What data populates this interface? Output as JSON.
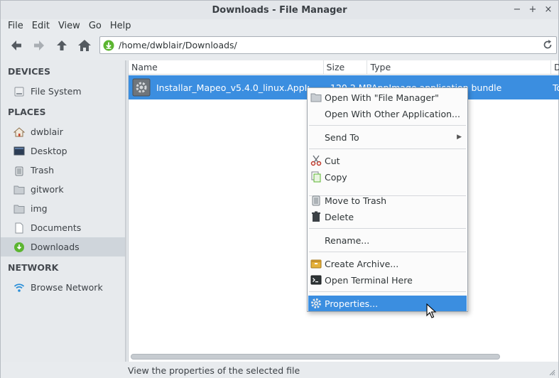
{
  "window": {
    "title": "Downloads - File Manager",
    "buttons": [
      "−",
      "+",
      "×"
    ]
  },
  "menubar": [
    "File",
    "Edit",
    "View",
    "Go",
    "Help"
  ],
  "toolbar": {
    "address": "/home/dwblair/Downloads/"
  },
  "sidebar": {
    "devices_header": "DEVICES",
    "devices": [
      {
        "label": "File System",
        "icon": "drive-icon"
      }
    ],
    "places_header": "PLACES",
    "places": [
      {
        "label": "dwblair",
        "icon": "home-icon"
      },
      {
        "label": "Desktop",
        "icon": "desktop-icon"
      },
      {
        "label": "Trash",
        "icon": "trash-icon"
      },
      {
        "label": "gitwork",
        "icon": "folder-icon"
      },
      {
        "label": "img",
        "icon": "folder-icon"
      },
      {
        "label": "Documents",
        "icon": "documents-icon"
      },
      {
        "label": "Downloads",
        "icon": "downloads-icon",
        "active": true
      }
    ],
    "network_header": "NETWORK",
    "network": [
      {
        "label": "Browse Network",
        "icon": "wifi-icon"
      }
    ]
  },
  "file_list": {
    "columns": [
      "Name",
      "Size",
      "Type",
      "D"
    ],
    "rows": [
      {
        "name": "Installar_Mapeo_v5.4.0_linux.AppImage",
        "size": "120.2 MB",
        "type": "AppImage application bundle",
        "date": "To"
      }
    ]
  },
  "context_menu": {
    "items": [
      {
        "label": "Open With \"File Manager\"",
        "icon": "folder-icon"
      },
      {
        "label": "Open With Other Application...",
        "icon": ""
      },
      {
        "label": "Send To",
        "icon": "",
        "submenu": true
      },
      {
        "label": "Cut",
        "icon": "scissors-icon"
      },
      {
        "label": "Copy",
        "icon": "copy-icon"
      },
      {
        "label": "Move to Trash",
        "icon": "trash-icon"
      },
      {
        "label": "Delete",
        "icon": "delete-icon"
      },
      {
        "label": "Rename...",
        "icon": ""
      },
      {
        "label": "Create Archive...",
        "icon": "archive-icon"
      },
      {
        "label": "Open Terminal Here",
        "icon": "terminal-icon"
      },
      {
        "label": "Properties...",
        "icon": "gear-icon",
        "highlighted": true
      }
    ]
  },
  "statusbar": {
    "text": "View the properties of the selected file"
  },
  "colors": {
    "selection": "#3b8ee0",
    "accent_green": "#5cb531"
  }
}
